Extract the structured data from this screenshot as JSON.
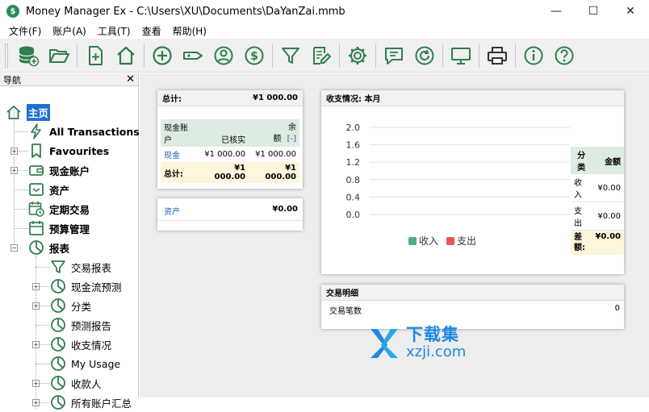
{
  "window": {
    "title": "Money Manager Ex - C:\\Users\\XU\\Documents\\DaYanZai.mmb",
    "app_icon": "$"
  },
  "menu": [
    "文件(F)",
    "账户(A)",
    "工具(T)",
    "查看",
    "帮助(H)"
  ],
  "toolbar": {
    "icons": [
      "database-add-icon",
      "folder-open-icon",
      "new-file-icon",
      "home-icon",
      "add-circle-icon",
      "tag-icon",
      "user-icon",
      "dollar-icon",
      "filter-icon",
      "edit-icon",
      "gear-icon",
      "chat-icon",
      "refresh-icon",
      "monitor-icon",
      "print-icon",
      "info-icon",
      "help-icon"
    ]
  },
  "nav": {
    "header": "导航",
    "items": [
      {
        "label": "主页",
        "icon": "home-icon"
      },
      {
        "label": "All Transactions",
        "icon": "lightning-icon"
      },
      {
        "label": "Favourites",
        "icon": "bookmark-icon"
      },
      {
        "label": "现金账户",
        "icon": "wallet-icon"
      },
      {
        "label": "资产",
        "icon": "asset-icon"
      },
      {
        "label": "定期交易",
        "icon": "calendar-clock-icon"
      },
      {
        "label": "预算管理",
        "icon": "calendar-icon"
      },
      {
        "label": "报表",
        "icon": "pie-chart-icon"
      },
      {
        "label": "交易报表",
        "icon": "filter-icon"
      },
      {
        "label": "现金流预测",
        "icon": "pie-chart-icon"
      },
      {
        "label": "分类",
        "icon": "pie-chart-icon"
      },
      {
        "label": "预测报告",
        "icon": "pie-chart-icon"
      },
      {
        "label": "收支情况",
        "icon": "pie-chart-icon"
      },
      {
        "label": "My Usage",
        "icon": "pie-chart-icon"
      },
      {
        "label": "收款人",
        "icon": "pie-chart-icon"
      },
      {
        "label": "所有账户汇总",
        "icon": "pie-chart-icon"
      }
    ]
  },
  "summary": {
    "title": "总计:",
    "total": "¥1 000.00",
    "columns": {
      "account": "现金账户",
      "reconciled": "已核实",
      "balance_top": "余",
      "balance_bottom": "额",
      "collapse": "[-]"
    },
    "rows": [
      {
        "name": "现金",
        "reconciled": "¥1 000.00",
        "balance": "¥1 000.00"
      }
    ],
    "footer": {
      "label": "总计:",
      "reconciled": "¥1 000.00",
      "balance": "¥1 000.00"
    }
  },
  "assets": {
    "label": "资产",
    "value": "¥0.00"
  },
  "income_expense": {
    "title": "收支情况: 本月",
    "table": {
      "col1": "分类",
      "col2": "金额",
      "income_label": "收入",
      "income_value": "¥0.00",
      "expense_label": "支出",
      "expense_value": "¥0.00",
      "diff_label1": "差",
      "diff_label2": "额:",
      "diff_value": "¥0.00"
    }
  },
  "chart_data": {
    "type": "bar",
    "categories": [
      ""
    ],
    "series": [
      {
        "name": "收入",
        "values": [
          0
        ]
      },
      {
        "name": "支出",
        "values": [
          0
        ]
      }
    ],
    "ylim": [
      0,
      2.0
    ],
    "yticks": [
      "2.0",
      "1.6",
      "1.2",
      "0.8",
      "0.4",
      "0.0"
    ],
    "colors": {
      "收入": "#4caf7d",
      "支出": "#ef5350"
    },
    "grid": true,
    "legend": "bottom"
  },
  "transactions": {
    "title": "交易明细",
    "row_label": "交易笔数",
    "row_value": "0"
  },
  "watermark": {
    "brand": "下载集",
    "site": "xzji.com"
  }
}
